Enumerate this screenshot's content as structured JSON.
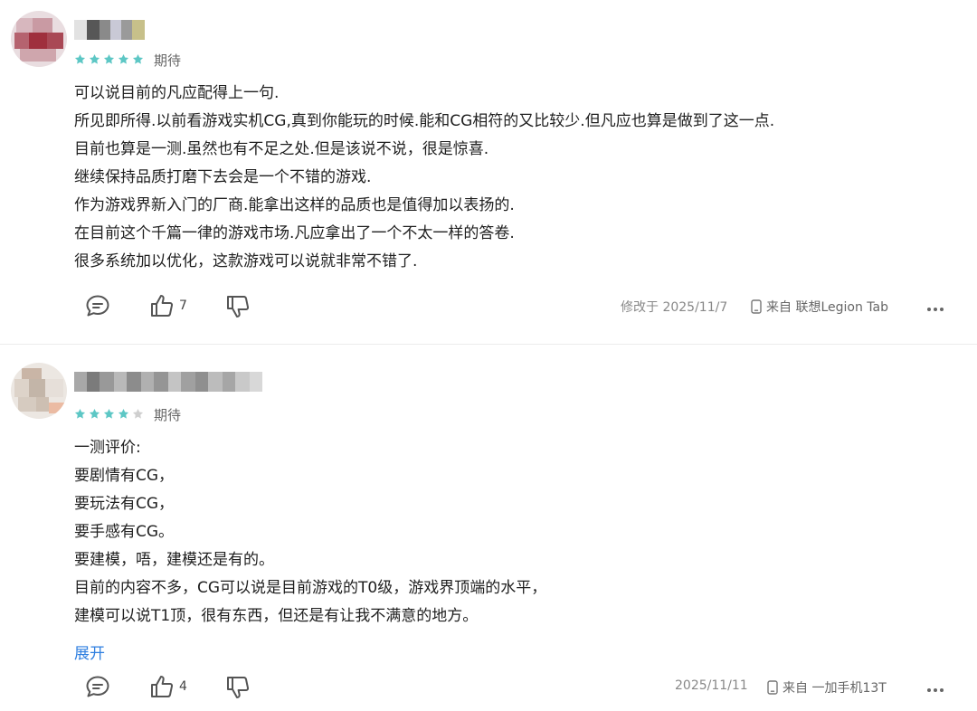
{
  "colors": {
    "star_filled": "#5dc7c5",
    "star_empty": "#cfcfcf",
    "link": "#2f7fe0",
    "text": "#1f1f1f",
    "meta": "#888888"
  },
  "reviews": [
    {
      "rating": 5,
      "tag": "期待",
      "lines": [
        "可以说目前的凡应配得上一句.",
        "所见即所得.以前看游戏实机CG,真到你能玩的时候.能和CG相符的又比较少.但凡应也算是做到了这一点.",
        "目前也算是一测.虽然也有不足之处.但是该说不说，很是惊喜.",
        "继续保持品质打磨下去会是一个不错的游戏.",
        "作为游戏界新入门的厂商.能拿出这样的品质也是值得加以表扬的.",
        "在目前这个千篇一律的游戏市场.凡应拿出了一个不太一样的答卷.",
        "很多系统加以优化，这款游戏可以说就非常不错了."
      ],
      "like_count": "7",
      "date": "修改于 2025/11/7",
      "device": "来自 联想Legion Tab",
      "icons": {
        "comment": "comment-icon",
        "like": "thumbs-up-icon",
        "dislike": "thumbs-down-icon",
        "device": "phone-icon",
        "more": "more-dots-icon"
      }
    },
    {
      "rating": 4,
      "tag": "期待",
      "lines": [
        "一测评价:",
        "要剧情有CG，",
        "要玩法有CG，",
        "要手感有CG。",
        "要建模，唔，建模还是有的。",
        "目前的内容不多，CG可以说是目前游戏的T0级，游戏界顶端的水平，",
        "建模可以说T1顶，很有东西，但还是有让我不满意的地方。"
      ],
      "expand_label": "展开",
      "like_count": "4",
      "date": "2025/11/11",
      "device": "来自 一加手机13T",
      "icons": {
        "comment": "comment-icon",
        "like": "thumbs-up-icon",
        "dislike": "thumbs-down-icon",
        "device": "phone-icon",
        "more": "more-dots-icon"
      }
    }
  ]
}
